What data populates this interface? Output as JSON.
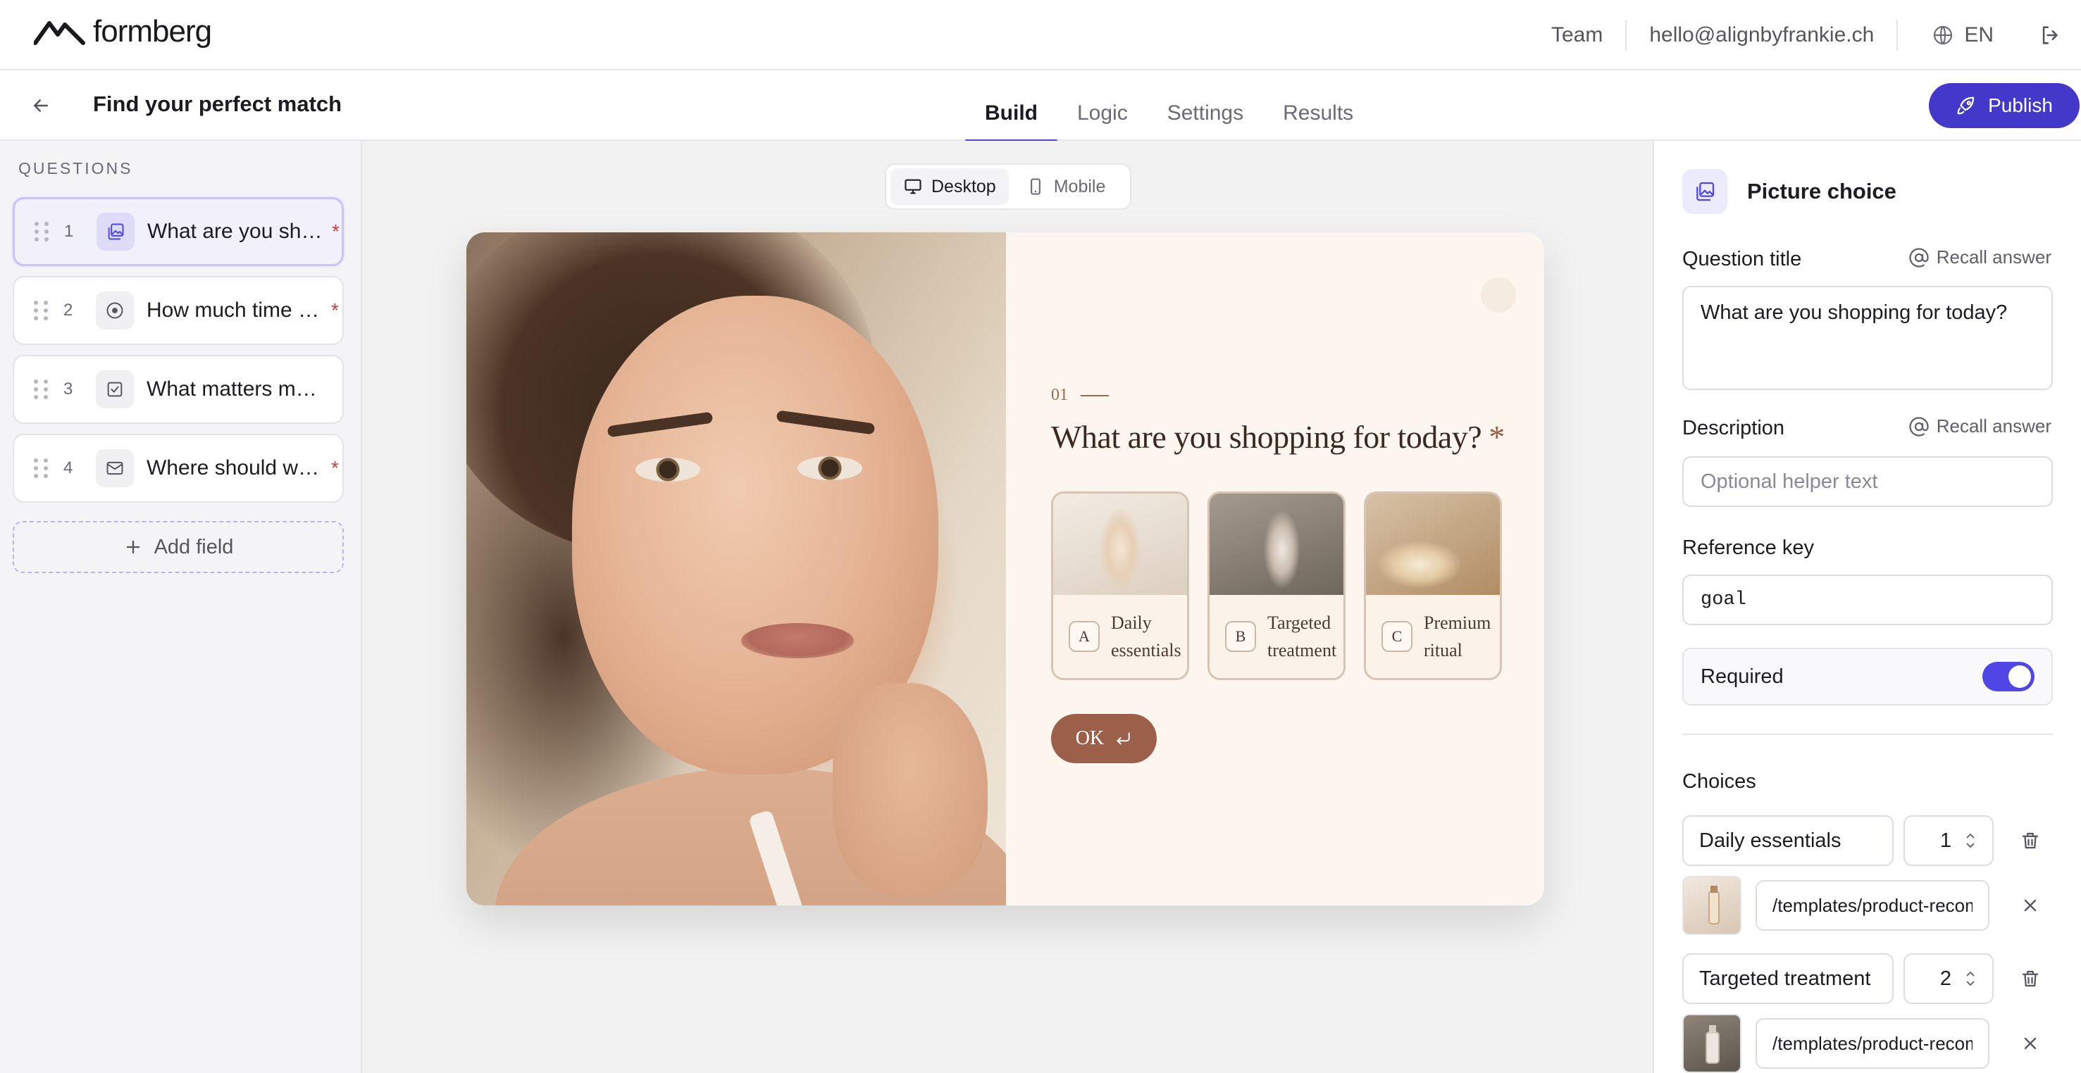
{
  "app": {
    "logo_text": "formberg"
  },
  "topbar": {
    "team_label": "Team",
    "user_email": "hello@alignbyfrankie.ch",
    "language": "EN"
  },
  "subbar": {
    "form_title": "Find your perfect match",
    "tabs": [
      {
        "label": "Build",
        "active": true
      },
      {
        "label": "Logic",
        "active": false
      },
      {
        "label": "Settings",
        "active": false
      },
      {
        "label": "Results",
        "active": false
      }
    ],
    "publish_label": "Publish"
  },
  "sidebar": {
    "heading": "QUESTIONS",
    "questions": [
      {
        "number": "1",
        "text": "What are you shopping for today?",
        "required": "*",
        "icon": "picture-choice-icon",
        "selected": true
      },
      {
        "number": "2",
        "text": "How much time do you have?",
        "required": "*",
        "icon": "radio-icon",
        "selected": false
      },
      {
        "number": "3",
        "text": "What matters most to you?",
        "required": "",
        "icon": "checkbox-icon",
        "selected": false
      },
      {
        "number": "4",
        "text": "Where should we send your results?",
        "required": "*",
        "icon": "email-icon",
        "selected": false
      }
    ],
    "add_field_label": "Add field"
  },
  "canvas": {
    "device_toggle": {
      "desktop_label": "Desktop",
      "mobile_label": "Mobile",
      "active": "desktop"
    },
    "preview": {
      "step_number": "01",
      "question_title": "What are you shopping for today?",
      "required_marker": "*",
      "choices": [
        {
          "key": "A",
          "label": "Daily essentials"
        },
        {
          "key": "B",
          "label": "Targeted treatment"
        },
        {
          "key": "C",
          "label": "Premium ritual"
        }
      ],
      "ok_label": "OK"
    }
  },
  "panel": {
    "question_type": "Picture choice",
    "question_title_label": "Question title",
    "recall_label": "Recall answer",
    "question_title_value": "What are you shopping for today?",
    "description_label": "Description",
    "description_placeholder": "Optional helper text",
    "reference_key_label": "Reference key",
    "reference_key_value": "goal",
    "required_label": "Required",
    "required_on": true,
    "choices_label": "Choices",
    "choices": [
      {
        "name": "Daily essentials",
        "value": "1",
        "image_path": "/templates/product-recommendation/daily-essentials.jpg"
      },
      {
        "name": "Targeted treatment",
        "value": "2",
        "image_path": "/templates/product-recommendation/targeted-treatment.jpg"
      }
    ]
  },
  "colors": {
    "accent": "#4f46e5",
    "publish": "#4338ca",
    "preview_bg": "#fdf6ee",
    "preview_accent": "#9c5f49",
    "required": "#d9383a"
  }
}
